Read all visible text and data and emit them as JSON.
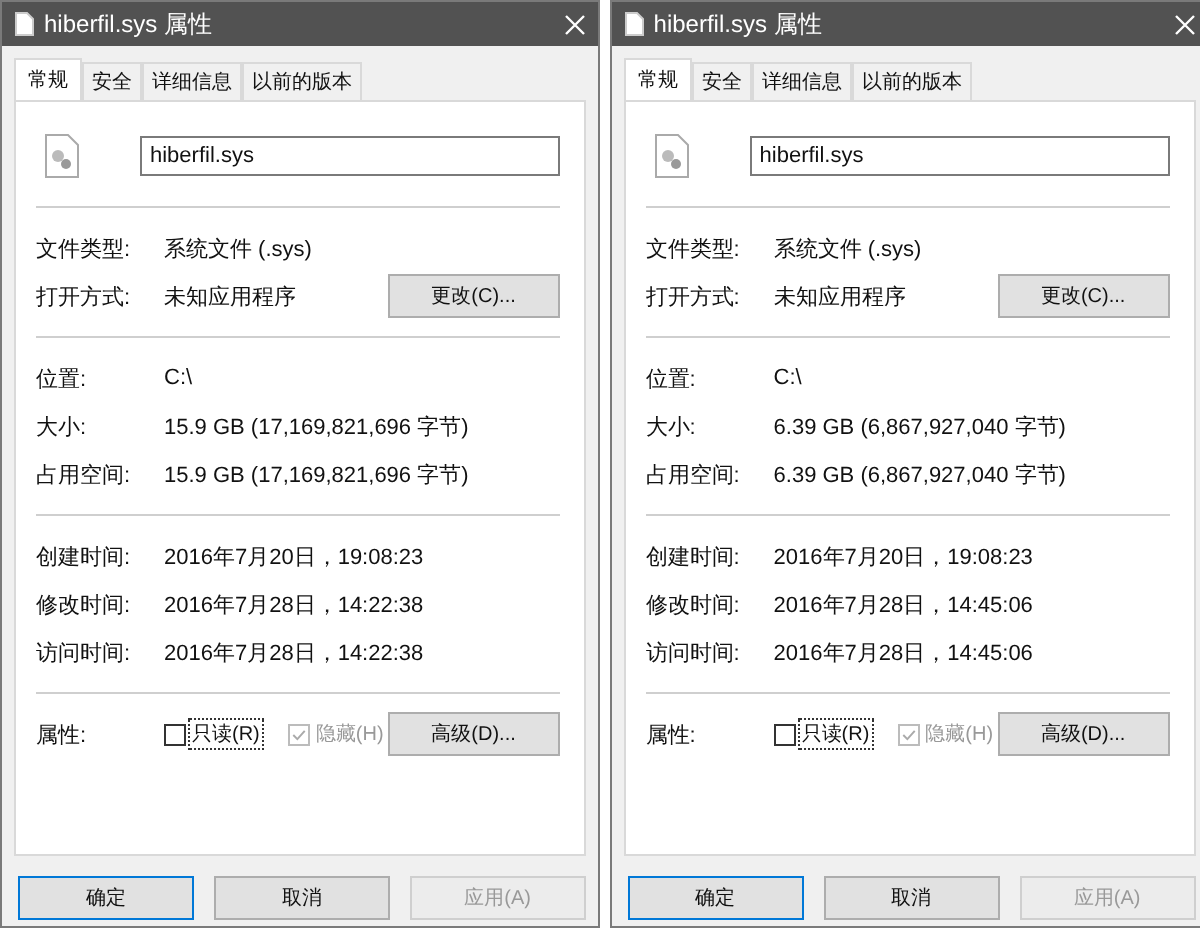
{
  "windows": [
    {
      "title": "hiberfil.sys 属性",
      "tabs": [
        {
          "label": "常规",
          "selected": true
        },
        {
          "label": "安全",
          "selected": false
        },
        {
          "label": "详细信息",
          "selected": false
        },
        {
          "label": "以前的版本",
          "selected": false
        }
      ],
      "file_name": "hiberfil.sys",
      "groups": [
        [
          {
            "label": "文件类型:",
            "value": "系统文件 (.sys)"
          },
          {
            "label": "打开方式:",
            "value": "未知应用程序",
            "button": "更改(C)..."
          }
        ],
        [
          {
            "label": "位置:",
            "value": "C:\\"
          },
          {
            "label": "大小:",
            "value": "15.9 GB (17,169,821,696 字节)"
          },
          {
            "label": "占用空间:",
            "value": "15.9 GB (17,169,821,696 字节)"
          }
        ],
        [
          {
            "label": "创建时间:",
            "value": "2016年7月20日，19:08:23"
          },
          {
            "label": "修改时间:",
            "value": "2016年7月28日，14:22:38"
          },
          {
            "label": "访问时间:",
            "value": "2016年7月28日，14:22:38"
          }
        ]
      ],
      "attributes": {
        "label": "属性:",
        "options": [
          {
            "label": "只读(R)",
            "checked": false,
            "disabled": false,
            "focused": true
          },
          {
            "label": "隐藏(H)",
            "checked": true,
            "disabled": true,
            "focused": false
          }
        ],
        "button": "高级(D)..."
      },
      "buttons": [
        {
          "label": "确定",
          "default": true,
          "disabled": false
        },
        {
          "label": "取消",
          "default": false,
          "disabled": false
        },
        {
          "label": "应用(A)",
          "default": false,
          "disabled": true
        }
      ]
    },
    {
      "title": "hiberfil.sys 属性",
      "tabs": [
        {
          "label": "常规",
          "selected": true
        },
        {
          "label": "安全",
          "selected": false
        },
        {
          "label": "详细信息",
          "selected": false
        },
        {
          "label": "以前的版本",
          "selected": false
        }
      ],
      "file_name": "hiberfil.sys",
      "groups": [
        [
          {
            "label": "文件类型:",
            "value": "系统文件 (.sys)"
          },
          {
            "label": "打开方式:",
            "value": "未知应用程序",
            "button": "更改(C)..."
          }
        ],
        [
          {
            "label": "位置:",
            "value": "C:\\"
          },
          {
            "label": "大小:",
            "value": "6.39 GB (6,867,927,040 字节)"
          },
          {
            "label": "占用空间:",
            "value": "6.39 GB (6,867,927,040 字节)"
          }
        ],
        [
          {
            "label": "创建时间:",
            "value": "2016年7月20日，19:08:23"
          },
          {
            "label": "修改时间:",
            "value": "2016年7月28日，14:45:06"
          },
          {
            "label": "访问时间:",
            "value": "2016年7月28日，14:45:06"
          }
        ]
      ],
      "attributes": {
        "label": "属性:",
        "options": [
          {
            "label": "只读(R)",
            "checked": false,
            "disabled": false,
            "focused": true
          },
          {
            "label": "隐藏(H)",
            "checked": true,
            "disabled": true,
            "focused": false
          }
        ],
        "button": "高级(D)..."
      },
      "buttons": [
        {
          "label": "确定",
          "default": true,
          "disabled": false
        },
        {
          "label": "取消",
          "default": false,
          "disabled": false
        },
        {
          "label": "应用(A)",
          "default": false,
          "disabled": true
        }
      ]
    }
  ]
}
